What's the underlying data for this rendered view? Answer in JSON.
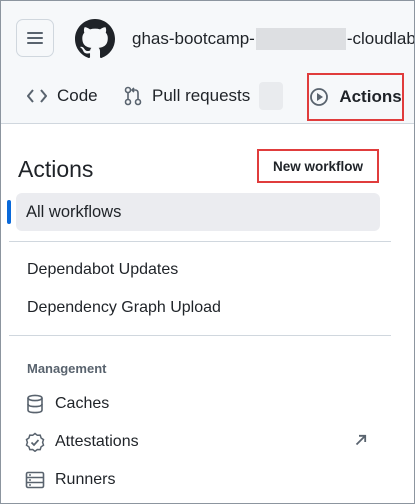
{
  "header": {
    "repo_prefix": "ghas-bootcamp-",
    "repo_suffix": "-cloudlabs",
    "tabs": [
      {
        "label": "Code",
        "icon": "code-icon"
      },
      {
        "label": "Pull requests",
        "icon": "pull-request-icon"
      },
      {
        "label": "Actions",
        "icon": "play-icon"
      }
    ]
  },
  "sidebar": {
    "title": "Actions",
    "new_workflow_label": "New workflow",
    "all_workflows_label": "All workflows",
    "workflows": [
      "Dependabot Updates",
      "Dependency Graph Upload"
    ],
    "management_heading": "Management",
    "management_items": [
      {
        "label": "Caches",
        "icon": "database-icon"
      },
      {
        "label": "Attestations",
        "icon": "verified-icon",
        "external": true
      },
      {
        "label": "Runners",
        "icon": "server-icon"
      }
    ]
  },
  "colors": {
    "highlight_border": "#e03c3c",
    "active_indicator": "#0969da",
    "header_bg": "#f6f8fa"
  }
}
